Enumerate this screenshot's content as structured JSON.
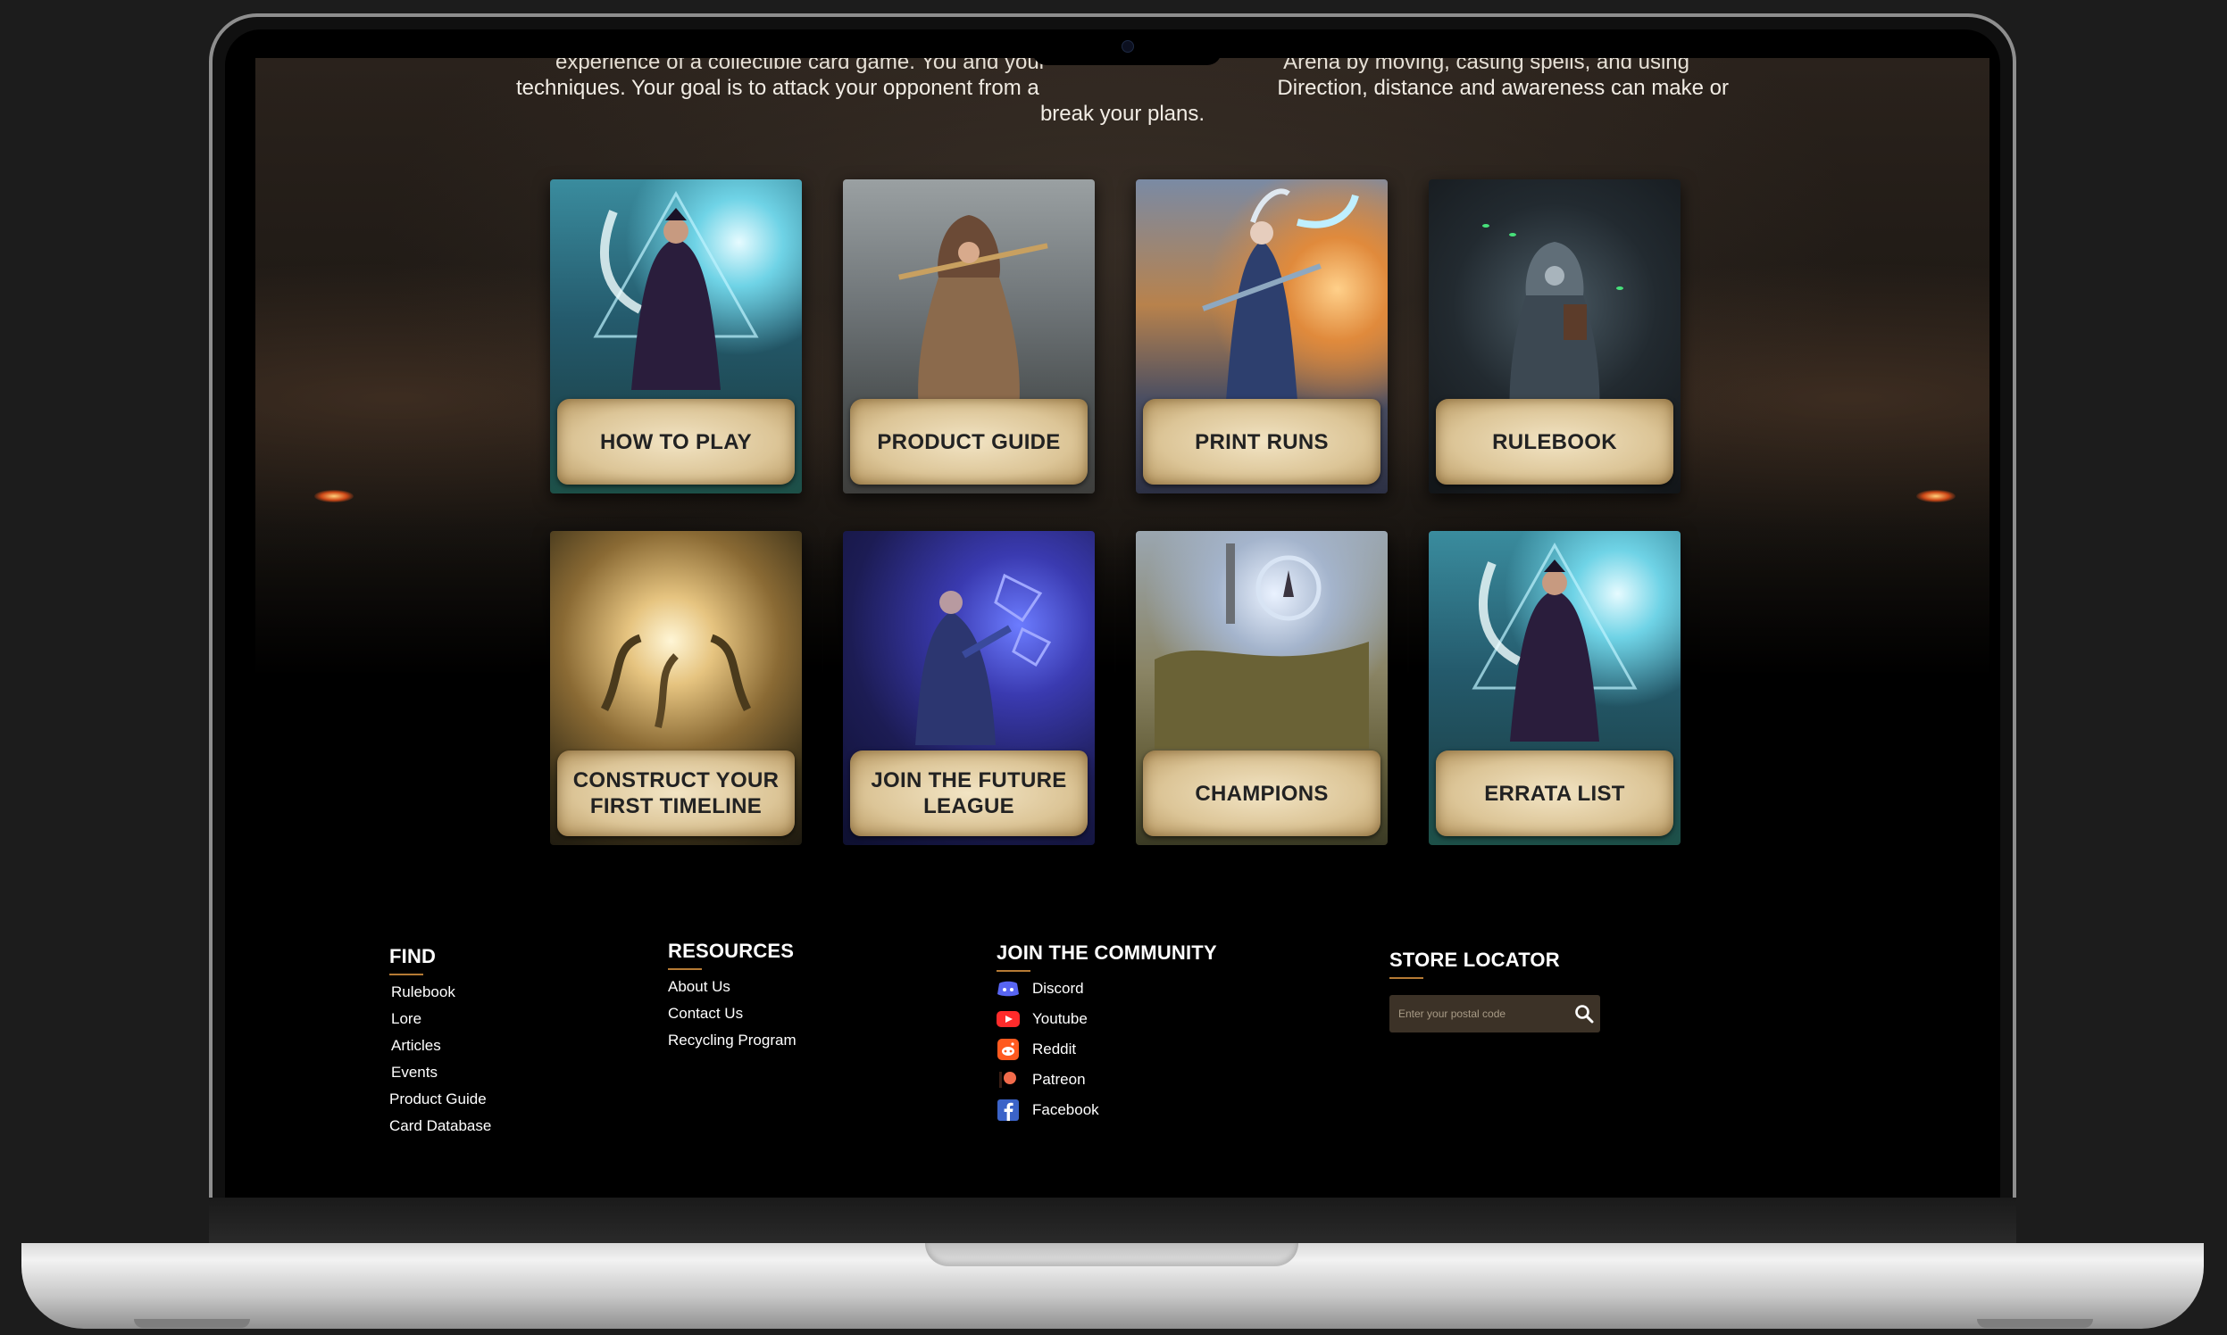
{
  "intro": {
    "line0": "experience of a collectible card game. You and your                                        Arena by moving, casting spells, and using",
    "line1": "techniques. Your goal is to attack your opponent from a                                        Direction, distance and awareness can make or",
    "line2": "break your plans."
  },
  "cards": [
    {
      "label": "HOW TO PLAY",
      "icon": "mage-art"
    },
    {
      "label": "PRODUCT GUIDE",
      "icon": "hooded-warrior-art"
    },
    {
      "label": "PRINT RUNS",
      "icon": "ice-warrior-art"
    },
    {
      "label": "RULEBOOK",
      "icon": "dark-reader-art"
    },
    {
      "label": "CONSTRUCT YOUR FIRST TIMELINE",
      "icon": "golden-vortex-art"
    },
    {
      "label": "JOIN THE FUTURE LEAGUE",
      "icon": "tech-warrior-art"
    },
    {
      "label": "CHAMPIONS",
      "icon": "storm-landscape-art"
    },
    {
      "label": "ERRATA LIST",
      "icon": "mage-art"
    }
  ],
  "footer": {
    "find": {
      "title": "FIND",
      "links": [
        "Rulebook",
        "Lore",
        "Articles",
        "Events",
        "Product Guide",
        "Card Database"
      ]
    },
    "resources": {
      "title": "RESOURCES",
      "links": [
        "About Us",
        "Contact Us",
        "Recycling Program"
      ]
    },
    "community": {
      "title": "JOIN THE COMMUNITY",
      "items": [
        {
          "label": "Discord",
          "icon": "discord-icon",
          "color": "#5865f2"
        },
        {
          "label": "Youtube",
          "icon": "youtube-icon",
          "color": "#ff2b2b"
        },
        {
          "label": "Reddit",
          "icon": "reddit-icon",
          "color": "#ff5a1f"
        },
        {
          "label": "Patreon",
          "icon": "patreon-icon",
          "color": "#f26b4b"
        },
        {
          "label": "Facebook",
          "icon": "facebook-icon",
          "color": "#3b63c8"
        }
      ]
    },
    "store": {
      "title": "STORE LOCATOR",
      "placeholder": "Enter your postal code",
      "icon": "search-icon"
    }
  },
  "colors": {
    "accent_underline": "#b57a34",
    "scroll_label_bg": "#dcc597",
    "page_bg": "#000000"
  }
}
